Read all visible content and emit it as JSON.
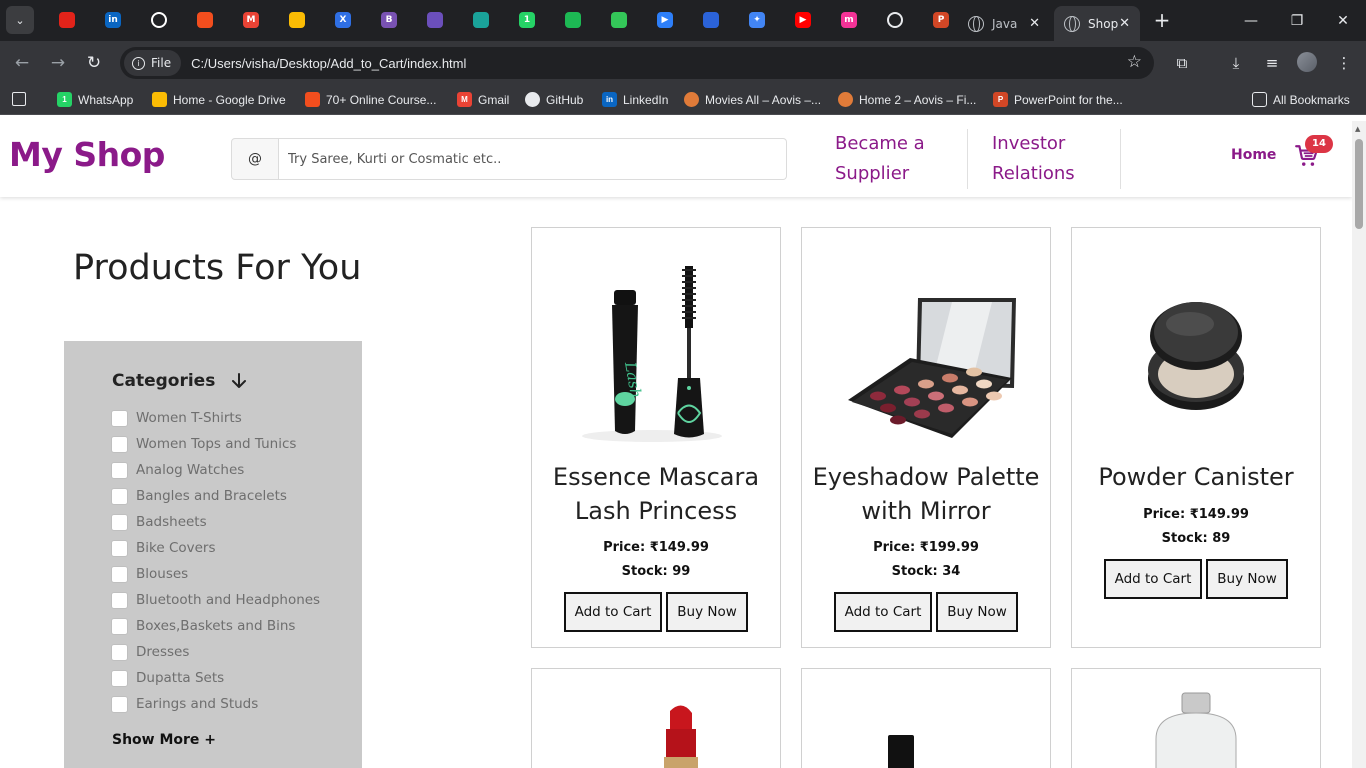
{
  "browser": {
    "pinned_tabs": [
      {
        "name": "flag-tab-icon",
        "glyph": "",
        "color": "#e2231a"
      },
      {
        "name": "linkedin-tab-icon",
        "glyph": "in",
        "color": "#0a66c2"
      },
      {
        "name": "github-tab-icon",
        "glyph": "",
        "color": "#ffffff"
      },
      {
        "name": "figma-tab-icon",
        "glyph": "",
        "color": "#f24e1e"
      },
      {
        "name": "gmail-tab-icon",
        "glyph": "M",
        "color": "#ea4335"
      },
      {
        "name": "drive-tab-icon",
        "glyph": "",
        "color": "#fbbc04"
      },
      {
        "name": "xd-tab-icon",
        "glyph": "X",
        "color": "#2f6fe4"
      },
      {
        "name": "bootstrap-tab-icon",
        "glyph": "B",
        "color": "#7952b3"
      },
      {
        "name": "coolors-tab-icon",
        "glyph": "",
        "color": "#6b4fbb"
      },
      {
        "name": "pw-tab-icon",
        "glyph": "",
        "color": "#1aa39a"
      },
      {
        "name": "whatsapp-tab-icon",
        "glyph": "1",
        "color": "#25d366"
      },
      {
        "name": "spotify-tab-icon",
        "glyph": "",
        "color": "#1db954"
      },
      {
        "name": "gradient-tab-icon",
        "glyph": "",
        "color": "#34c759"
      },
      {
        "name": "play-tab-icon",
        "glyph": "▶",
        "color": "#2d7ff9"
      },
      {
        "name": "flag-blue-tab-icon",
        "glyph": "",
        "color": "#2b63d9"
      },
      {
        "name": "gemini-tab-icon",
        "glyph": "✦",
        "color": "#4285f4"
      },
      {
        "name": "youtube-tab-icon",
        "glyph": "▶",
        "color": "#ff0000"
      },
      {
        "name": "meesho-tab-icon",
        "glyph": "m",
        "color": "#f43397"
      },
      {
        "name": "openai-tab-icon",
        "glyph": "",
        "color": "#e8eaed"
      },
      {
        "name": "powerpoint-tab-icon",
        "glyph": "P",
        "color": "#d24726"
      }
    ],
    "tabs": [
      {
        "title": "Java",
        "active": false
      },
      {
        "title": "Shop",
        "active": true
      }
    ],
    "address": {
      "scheme_label": "File",
      "url": "C:/Users/visha/Desktop/Add_to_Cart/index.html"
    },
    "bookmarks": [
      {
        "label": "WhatsApp",
        "icon": "whatsapp-icon",
        "color": "#25d366",
        "glyph": "1"
      },
      {
        "label": "Home - Google Drive",
        "icon": "google-drive-icon",
        "color": "#fbbc04",
        "glyph": ""
      },
      {
        "label": "70+ Online Course...",
        "icon": "figma-icon",
        "color": "#f24e1e",
        "glyph": ""
      },
      {
        "label": "Gmail",
        "icon": "gmail-icon",
        "color": "#ea4335",
        "glyph": "M"
      },
      {
        "label": "GitHub",
        "icon": "github-icon",
        "color": "#e8eaed",
        "glyph": ""
      },
      {
        "label": "LinkedIn",
        "icon": "linkedin-icon",
        "color": "#0a66c2",
        "glyph": "in"
      },
      {
        "label": "Movies All – Aovis –...",
        "icon": "aovis-icon",
        "color": "#e07b39",
        "glyph": ""
      },
      {
        "label": "Home 2 – Aovis – Fi...",
        "icon": "aovis-icon",
        "color": "#e07b39",
        "glyph": ""
      },
      {
        "label": "PowerPoint for the...",
        "icon": "powerpoint-icon",
        "color": "#d24726",
        "glyph": "P"
      }
    ],
    "all_bookmarks_label": "All Bookmarks"
  },
  "site": {
    "logo": "My Shop",
    "search": {
      "addon": "@",
      "placeholder": "Try Saree, Kurti or Cosmatic etc.."
    },
    "nav": {
      "supplier_line1": "Became a",
      "supplier_line2": "Supplier",
      "investor_line1": "Investor",
      "investor_line2": "Relations",
      "home": "Home"
    },
    "cart_count": "14",
    "accent_color": "#8b1a89",
    "badge_color": "#dc3545"
  },
  "page": {
    "heading": "Products For You"
  },
  "sidebar": {
    "title": "Categories",
    "categories": [
      "Women T-Shirts",
      "Women Tops and Tunics",
      "Analog Watches",
      "Bangles and Bracelets",
      "Badsheets",
      "Bike Covers",
      "Blouses",
      "Bluetooth and Headphones",
      "Boxes,Baskets and Bins",
      "Dresses",
      "Dupatta Sets",
      "Earings and Studs"
    ],
    "show_more": "Show More +"
  },
  "products": [
    {
      "name_line1": "Essence Mascara",
      "name_line2": "Lash Princess",
      "price": "Price: ₹149.99",
      "stock": "Stock: 99",
      "image": "mascara-image"
    },
    {
      "name_line1": "Eyeshadow Palette",
      "name_line2": "with Mirror",
      "price": "Price: ₹199.99",
      "stock": "Stock: 34",
      "image": "eyeshadow-palette-image"
    },
    {
      "name_line1": "Powder Canister",
      "name_line2": "",
      "price": "Price: ₹149.99",
      "stock": "Stock: 89",
      "image": "powder-canister-image"
    }
  ],
  "buttons": {
    "add_to_cart": "Add to Cart",
    "buy_now": "Buy Now"
  },
  "next_row_images": [
    "red-lipstick-image",
    "nail-polish-image",
    "perfume-bottle-image"
  ]
}
